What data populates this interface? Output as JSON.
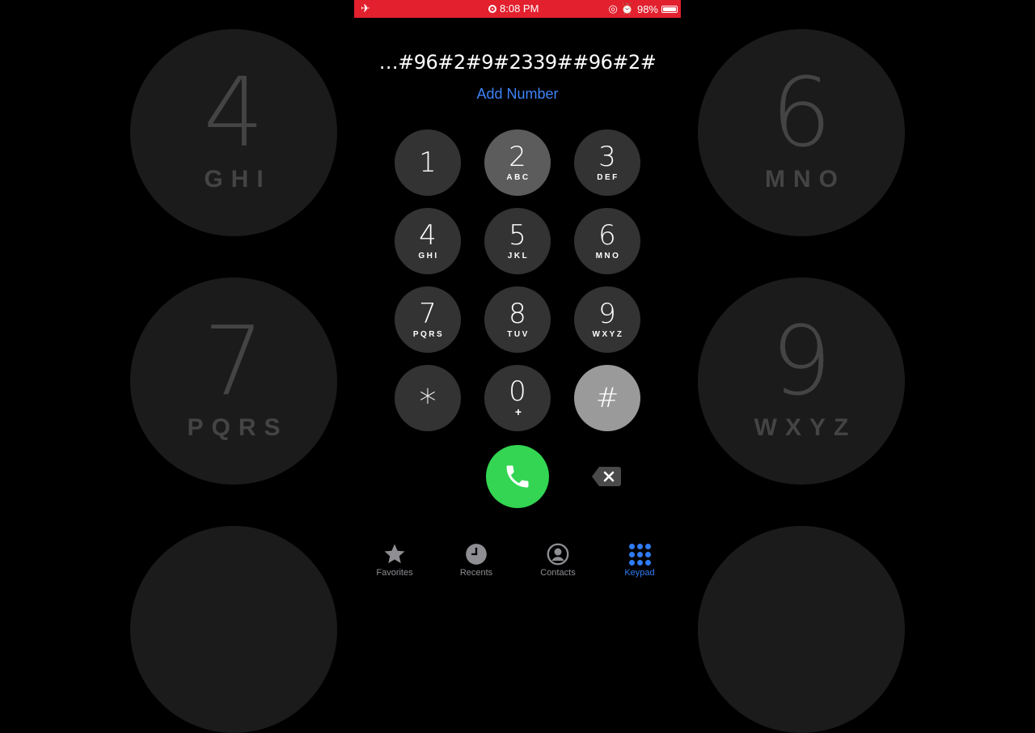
{
  "status_bar": {
    "time": "8:08 PM",
    "battery": "98%",
    "airplane_icon": "airplane-icon",
    "alarm_icon": "alarm-icon"
  },
  "dialer": {
    "number": "…#96#2#9#2339##96#2#",
    "add_number": "Add Number",
    "keys": [
      {
        "digit": "1",
        "letters": ""
      },
      {
        "digit": "2",
        "letters": "ABC"
      },
      {
        "digit": "3",
        "letters": "DEF"
      },
      {
        "digit": "4",
        "letters": "GHI"
      },
      {
        "digit": "5",
        "letters": "JKL"
      },
      {
        "digit": "6",
        "letters": "MNO"
      },
      {
        "digit": "7",
        "letters": "PQRS"
      },
      {
        "digit": "8",
        "letters": "TUV"
      },
      {
        "digit": "9",
        "letters": "WXYZ"
      },
      {
        "digit": "*",
        "letters": ""
      },
      {
        "digit": "0",
        "letters": "+"
      },
      {
        "digit": "#",
        "letters": ""
      }
    ]
  },
  "tabs": [
    {
      "label": "Favorites",
      "icon": "star-icon"
    },
    {
      "label": "Recents",
      "icon": "clock-icon"
    },
    {
      "label": "Contacts",
      "icon": "person-icon"
    },
    {
      "label": "Keypad",
      "icon": "keypad-icon",
      "active": true
    }
  ],
  "background": {
    "keys": [
      {
        "digit": "4",
        "letters": "GHI"
      },
      {
        "digit": "6",
        "letters": "MNO"
      },
      {
        "digit": "7",
        "letters": "PQRS"
      },
      {
        "digit": "9",
        "letters": "WXYZ"
      }
    ]
  },
  "colors": {
    "accent": "#3d83f6",
    "status_bar": "#e2202e",
    "call_button": "#33d552",
    "key": "#333333"
  }
}
